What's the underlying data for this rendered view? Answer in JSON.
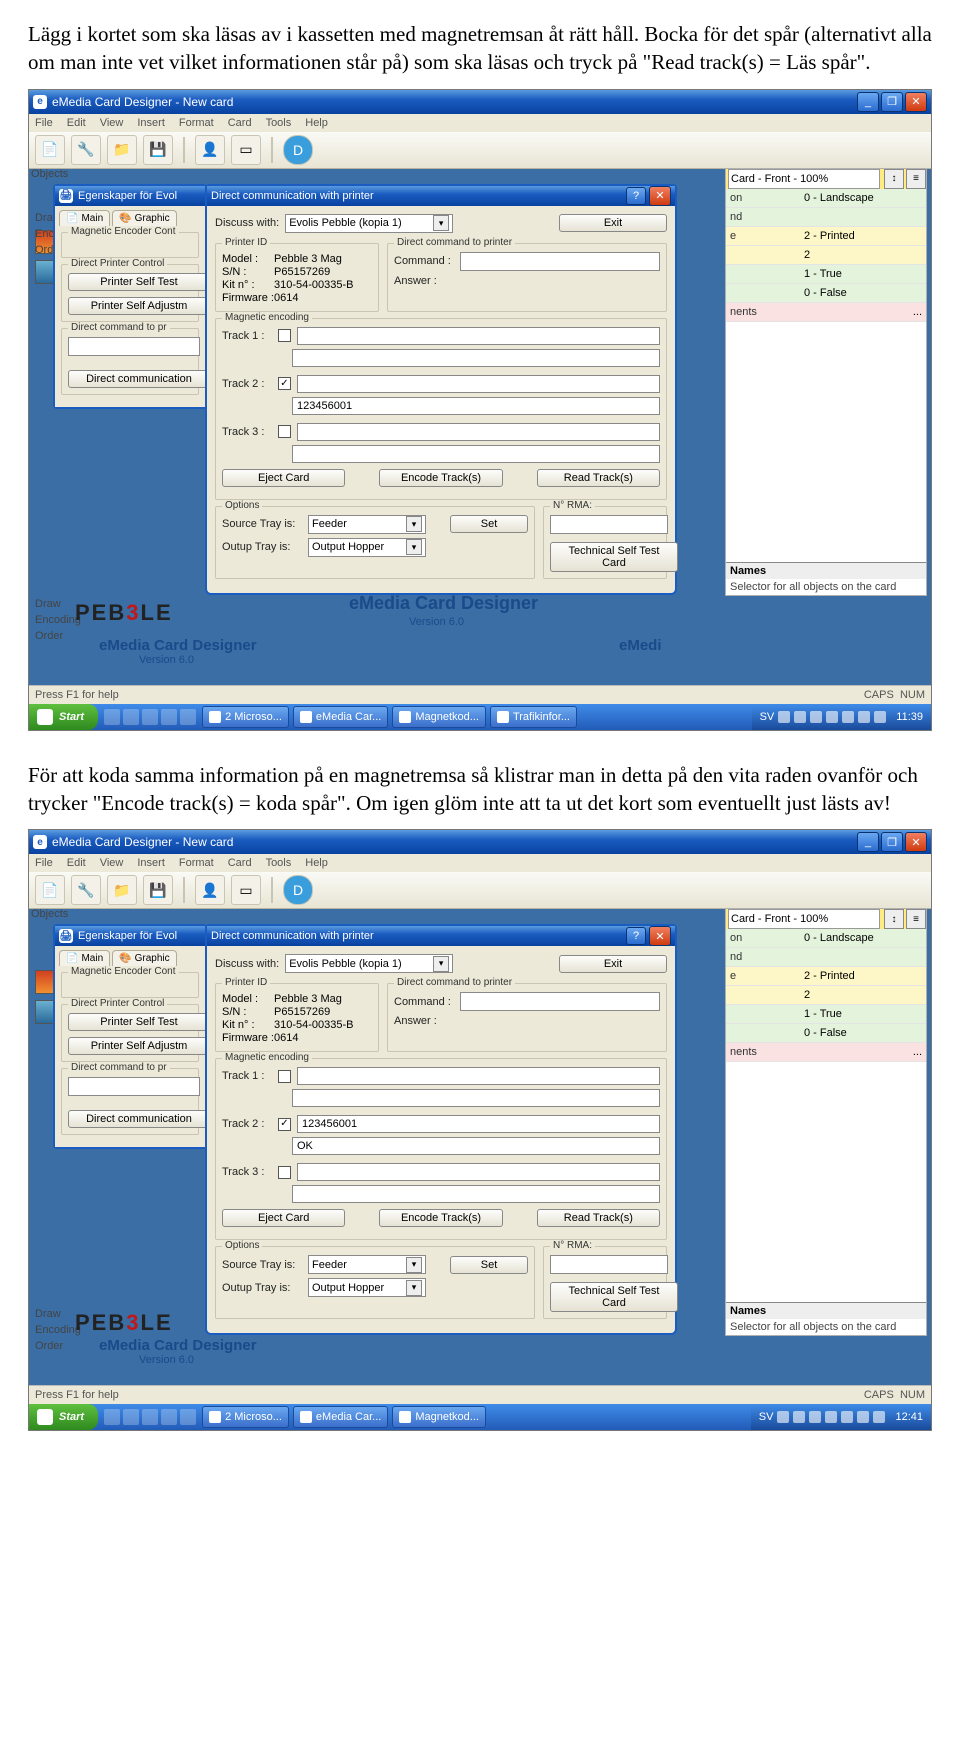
{
  "para1": "Lägg i kortet som ska läsas av i kassetten med magnetremsan åt rätt håll. Bocka för det spår (alternativt alla om man inte vet vilket informationen står på) som ska läsas och tryck på \"Read track(s) = Läs spår\".",
  "para2": "För att koda samma information på en magnetremsa så klistrar man in detta på den vita raden ovanför och trycker \"Encode track(s) = koda spår\". Om igen glöm inte att ta ut det kort som eventuellt just lästs av!",
  "app": {
    "title": "eMedia Card Designer - New card",
    "menus": [
      "File",
      "Edit",
      "View",
      "Insert",
      "Format",
      "Card",
      "Tools",
      "Help"
    ],
    "objects_label": "Objects",
    "leftrows": [
      "Draw",
      "Encoding",
      "Order"
    ],
    "status": "Press F1 for help",
    "caps": "CAPS",
    "num": "NUM",
    "brand": "eMedia Card Designer",
    "brand_sub": "Version 6.0"
  },
  "props": {
    "head": "Card - Front - 100%",
    "rows": [
      {
        "k": "on",
        "v": "0 - Landscape",
        "c": "g1"
      },
      {
        "k": "nd",
        "v": "",
        "c": "g1"
      },
      {
        "k": "e",
        "v": "2 - Printed",
        "c": "g2"
      },
      {
        "k": "",
        "v": "2",
        "c": "g2"
      },
      {
        "k": "",
        "v": "1 - True",
        "c": "g1"
      },
      {
        "k": "",
        "v": "0 - False",
        "c": "g1"
      },
      {
        "k": "nents",
        "v": "...",
        "c": "g3"
      }
    ],
    "names_h": "Names",
    "names_d": "Selector for all objects on the card"
  },
  "backwin": {
    "title": "Egenskaper för Evol",
    "tab_main": "Main",
    "tab_graphic": "Graphic",
    "grp1": "Magnetic Encoder Cont",
    "grp2": "Direct Printer Control",
    "btn_selftest": "Printer Self Test",
    "btn_adjust": "Printer Self Adjustm",
    "grp3": "Direct command to pr",
    "btn_comm": "Direct communication",
    "pebble": "PEB",
    "pebble_3": "3",
    "pebble_le": "LE"
  },
  "dlg": {
    "title": "Direct communication with printer",
    "discuss_lbl": "Discuss with:",
    "discuss_val": "Evolis Pebble (kopia 1)",
    "exit": "Exit",
    "grp_printer": "Printer ID",
    "model_k": "Model :",
    "model_v": "Pebble 3 Mag",
    "sn_k": "S/N :",
    "sn_v": "P65157269",
    "kit_k": "Kit n° :",
    "kit_v": "310-54-00335-B",
    "fw_k": "Firmware :",
    "fw_v": "0614",
    "grp_cmd": "Direct command to printer",
    "cmd_k": "Command :",
    "ans_k": "Answer :",
    "grp_mag": "Magnetic encoding",
    "t1": "Track 1 :",
    "t2": "Track 2 :",
    "t3": "Track 3 :",
    "eject": "Eject Card",
    "encode": "Encode Track(s)",
    "read": "Read Track(s)",
    "grp_opt": "Options",
    "src_k": "Source Tray is:",
    "src_v": "Feeder",
    "out_k": "Outup Tray is:",
    "out_v": "Output Hopper",
    "set": "Set",
    "rma_lbl": "N° RMA:",
    "selfcard": "Technical Self Test Card"
  },
  "screens": [
    {
      "t2_result": "123456001",
      "t2_input": "",
      "t2_checked": true,
      "clock": "11:39"
    },
    {
      "t2_result": "OK",
      "t2_input": "123456001",
      "t2_checked": true,
      "clock": "12:41"
    }
  ],
  "taskbar": {
    "start": "Start",
    "tasks": [
      "2 Microso...",
      "eMedia Car...",
      "Magnetkod...",
      "Trafikinfor..."
    ],
    "lang": "SV"
  }
}
